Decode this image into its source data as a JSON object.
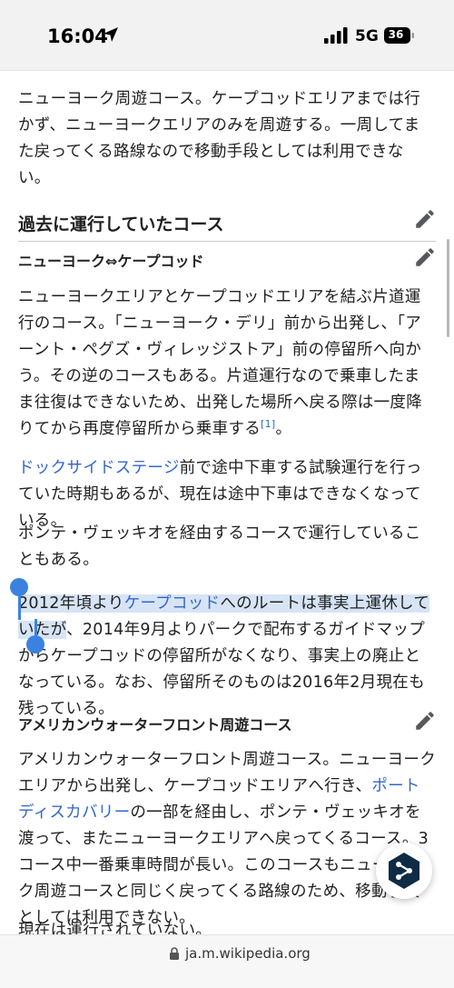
{
  "status_bar": {
    "time": "16:04",
    "network": "5G",
    "battery": "36"
  },
  "article": {
    "intro_paragraph": "ニューヨーク周遊コース。ケープコッドエリアまでは行かず、ニューヨークエリアのみを周遊する。一周してまた戻ってくる路線なので移動手段としては利用できない。",
    "section_heading": "過去に運行していたコース",
    "subsection1": {
      "heading": "ニューヨーク⇔ケープコッド",
      "para1": "ニューヨークエリアとケープコッドエリアを結ぶ片道運行のコース。「ニューヨーク・デリ」前から出発し、「アーント・ペグズ・ヴィレッジストア」前の停留所へ向かう。その逆のコースもある。片道運行なので乗車したまま往復はできないため、出発した場所へ戻る際は一度降りてから再度停留所から乗車する",
      "citation": "[1]",
      "para1_end": "。",
      "para2_link": "ドックサイドステージ",
      "para2_rest": "前で途中下車する試験運行を行っていた時期もあるが、現在は途中下車はできなくなっている。",
      "para3": "ポンテ・ヴェッキオを経由するコースで運行していることもある。",
      "para4_highlight_a": "2012年頃より",
      "para4_link": "ケープコッド",
      "para4_highlight_b": "へのルートは事実上運休していた",
      "para4_highlight_c": "が",
      "para4_rest": "、2014年9月よりパークで配布するガイドマップからケープコッドの停留所がなくなり、事実上の廃止となっている。なお、停留所そのものは2016年2月現在も残っている。"
    },
    "subsection2": {
      "heading": "アメリカンウォーターフロント周遊コース",
      "para1_a": "アメリカンウォーターフロント周遊コース。ニューヨークエリアから出発し、ケープコッドエリアへ行き、",
      "para1_link": "ポートディスカバリー",
      "para1_b": "の一部を経由し、ポンテ・ヴェッキオを渡って、またニューヨークエリアへ戻ってくるコース。3コース中一番乗車時間が長い。このコースもニューヨーク周遊コースと同じく戻ってくる路線のため、移動手段としては利用できない。",
      "para2_partial": "現在は運行されていない。"
    }
  },
  "url_bar": {
    "url": "ja.m.wikipedia.org"
  },
  "colors": {
    "link": "#3366cc",
    "selection": "#d6e4f5",
    "handle": "#3b82e0"
  },
  "icons": [
    "location-arrow-icon",
    "signal-icon",
    "battery-icon",
    "edit-pencil-icon",
    "lock-icon",
    "deepl-icon"
  ]
}
